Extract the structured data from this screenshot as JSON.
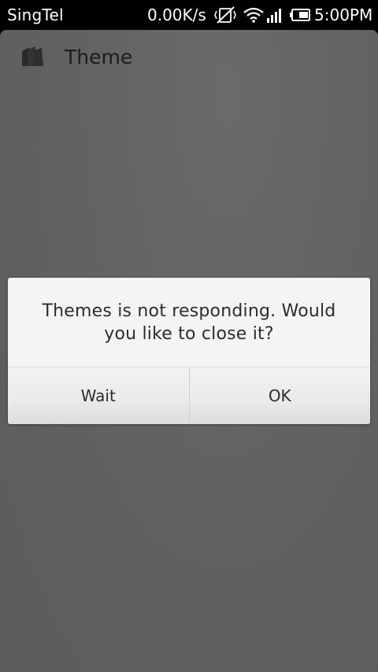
{
  "status_bar": {
    "carrier": "SingTel",
    "net_speed": "0.00K/s",
    "time": "5:00PM",
    "icons": [
      "muted-vibrate-icon",
      "wifi-icon",
      "signal-icon",
      "battery-icon"
    ]
  },
  "app": {
    "title": "Theme",
    "icon": "themes-app-icon"
  },
  "dialog": {
    "message": "Themes is not responding. Would you like to close it?",
    "buttons": {
      "wait": "Wait",
      "ok": "OK"
    }
  },
  "colors": {
    "status_bar_bg": "#000000",
    "dim_background": "#5e5e5e",
    "dialog_bg": "#f4f4f4",
    "text_dark": "#2c2c2c"
  }
}
